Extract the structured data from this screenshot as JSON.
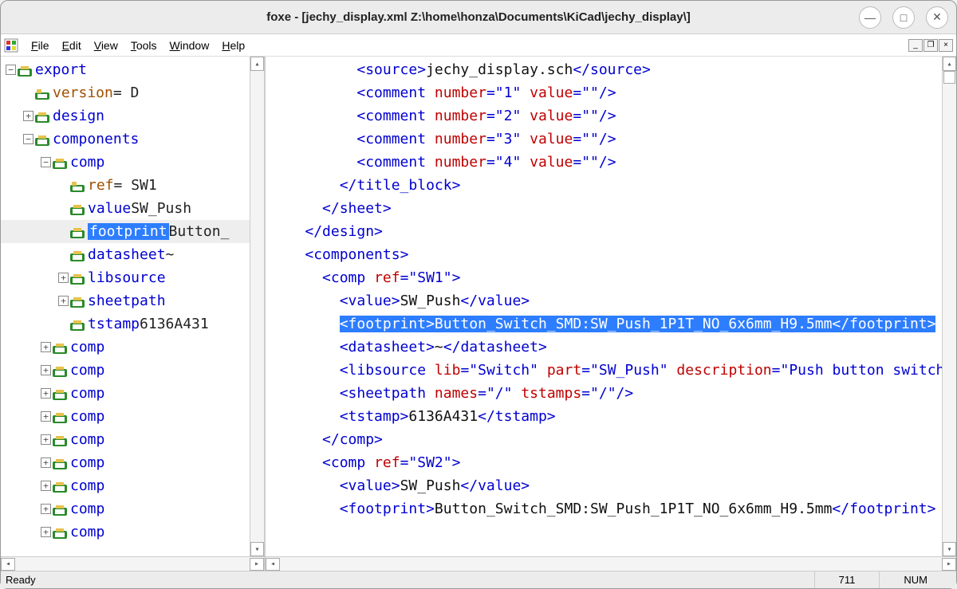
{
  "window": {
    "title": "foxe - [jechy_display.xml  Z:\\home\\honza\\Documents\\KiCad\\jechy_display\\]"
  },
  "menu": {
    "items": [
      "File",
      "Edit",
      "View",
      "Tools",
      "Window",
      "Help"
    ]
  },
  "tree": {
    "rows": [
      {
        "indent": 0,
        "exp": "-",
        "icon": "elem",
        "label": "export",
        "cls": "elem-name"
      },
      {
        "indent": 1,
        "exp": "",
        "icon": "attr",
        "label": "version",
        "cls": "brown",
        "val": " = D"
      },
      {
        "indent": 1,
        "exp": "+",
        "icon": "elem",
        "label": "design",
        "cls": "elem-name"
      },
      {
        "indent": 1,
        "exp": "-",
        "icon": "elem",
        "label": "components",
        "cls": "elem-name"
      },
      {
        "indent": 2,
        "exp": "-",
        "icon": "elem",
        "label": "comp",
        "cls": "elem-name"
      },
      {
        "indent": 3,
        "exp": "",
        "icon": "attr",
        "label": "ref",
        "cls": "brown",
        "val": " = SW1"
      },
      {
        "indent": 3,
        "exp": "",
        "icon": "elem",
        "label": "value",
        "cls": "elem-name",
        "val": " SW_Push"
      },
      {
        "indent": 3,
        "exp": "",
        "icon": "elem",
        "label": "footprint",
        "cls": "elem-name",
        "val": " Button_",
        "selected": true
      },
      {
        "indent": 3,
        "exp": "",
        "icon": "elem",
        "label": "datasheet",
        "cls": "elem-name",
        "val": " ~"
      },
      {
        "indent": 3,
        "exp": "+",
        "icon": "elem",
        "label": "libsource",
        "cls": "elem-name"
      },
      {
        "indent": 3,
        "exp": "+",
        "icon": "elem",
        "label": "sheetpath",
        "cls": "elem-name"
      },
      {
        "indent": 3,
        "exp": "",
        "icon": "elem",
        "label": "tstamp",
        "cls": "elem-name",
        "val": " 6136A431"
      },
      {
        "indent": 2,
        "exp": "+",
        "icon": "elem",
        "label": "comp",
        "cls": "elem-name"
      },
      {
        "indent": 2,
        "exp": "+",
        "icon": "elem",
        "label": "comp",
        "cls": "elem-name"
      },
      {
        "indent": 2,
        "exp": "+",
        "icon": "elem",
        "label": "comp",
        "cls": "elem-name"
      },
      {
        "indent": 2,
        "exp": "+",
        "icon": "elem",
        "label": "comp",
        "cls": "elem-name"
      },
      {
        "indent": 2,
        "exp": "+",
        "icon": "elem",
        "label": "comp",
        "cls": "elem-name"
      },
      {
        "indent": 2,
        "exp": "+",
        "icon": "elem",
        "label": "comp",
        "cls": "elem-name"
      },
      {
        "indent": 2,
        "exp": "+",
        "icon": "elem",
        "label": "comp",
        "cls": "elem-name"
      },
      {
        "indent": 2,
        "exp": "+",
        "icon": "elem",
        "label": "comp",
        "cls": "elem-name"
      },
      {
        "indent": 2,
        "exp": "+",
        "icon": "elem",
        "label": "comp",
        "cls": "elem-name"
      }
    ]
  },
  "xml": {
    "lines": [
      {
        "indent": 5,
        "tokens": [
          {
            "t": "<source>",
            "c": "tag"
          },
          {
            "t": "jechy_display.sch",
            "c": "txt"
          },
          {
            "t": "</source>",
            "c": "tag"
          }
        ]
      },
      {
        "indent": 5,
        "tokens": [
          {
            "t": "<comment ",
            "c": "tag"
          },
          {
            "t": "number",
            "c": "attr"
          },
          {
            "t": "=",
            "c": "tag"
          },
          {
            "t": "\"1\"",
            "c": "str"
          },
          {
            "t": " ",
            "c": "tag"
          },
          {
            "t": "value",
            "c": "attr"
          },
          {
            "t": "=",
            "c": "tag"
          },
          {
            "t": "\"\"",
            "c": "str"
          },
          {
            "t": "/>",
            "c": "tag"
          }
        ]
      },
      {
        "indent": 5,
        "tokens": [
          {
            "t": "<comment ",
            "c": "tag"
          },
          {
            "t": "number",
            "c": "attr"
          },
          {
            "t": "=",
            "c": "tag"
          },
          {
            "t": "\"2\"",
            "c": "str"
          },
          {
            "t": " ",
            "c": "tag"
          },
          {
            "t": "value",
            "c": "attr"
          },
          {
            "t": "=",
            "c": "tag"
          },
          {
            "t": "\"\"",
            "c": "str"
          },
          {
            "t": "/>",
            "c": "tag"
          }
        ]
      },
      {
        "indent": 5,
        "tokens": [
          {
            "t": "<comment ",
            "c": "tag"
          },
          {
            "t": "number",
            "c": "attr"
          },
          {
            "t": "=",
            "c": "tag"
          },
          {
            "t": "\"3\"",
            "c": "str"
          },
          {
            "t": " ",
            "c": "tag"
          },
          {
            "t": "value",
            "c": "attr"
          },
          {
            "t": "=",
            "c": "tag"
          },
          {
            "t": "\"\"",
            "c": "str"
          },
          {
            "t": "/>",
            "c": "tag"
          }
        ]
      },
      {
        "indent": 5,
        "tokens": [
          {
            "t": "<comment ",
            "c": "tag"
          },
          {
            "t": "number",
            "c": "attr"
          },
          {
            "t": "=",
            "c": "tag"
          },
          {
            "t": "\"4\"",
            "c": "str"
          },
          {
            "t": " ",
            "c": "tag"
          },
          {
            "t": "value",
            "c": "attr"
          },
          {
            "t": "=",
            "c": "tag"
          },
          {
            "t": "\"\"",
            "c": "str"
          },
          {
            "t": "/>",
            "c": "tag"
          }
        ]
      },
      {
        "indent": 4,
        "tokens": [
          {
            "t": "</title_block>",
            "c": "tag"
          }
        ]
      },
      {
        "indent": 3,
        "tokens": [
          {
            "t": "</sheet>",
            "c": "tag"
          }
        ]
      },
      {
        "indent": 2,
        "tokens": [
          {
            "t": "</design>",
            "c": "tag"
          }
        ]
      },
      {
        "indent": 2,
        "tokens": [
          {
            "t": "<components>",
            "c": "tag"
          }
        ]
      },
      {
        "indent": 3,
        "tokens": [
          {
            "t": "<comp ",
            "c": "tag"
          },
          {
            "t": "ref",
            "c": "attr"
          },
          {
            "t": "=",
            "c": "tag"
          },
          {
            "t": "\"SW1\"",
            "c": "str"
          },
          {
            "t": ">",
            "c": "tag"
          }
        ]
      },
      {
        "indent": 4,
        "tokens": [
          {
            "t": "<value>",
            "c": "tag"
          },
          {
            "t": "SW_Push",
            "c": "txt"
          },
          {
            "t": "</value>",
            "c": "tag"
          }
        ]
      },
      {
        "indent": 4,
        "hl": true,
        "tokens": [
          {
            "t": "<footprint>",
            "c": "tag"
          },
          {
            "t": "Button_Switch_SMD:SW_Push_1P1T_NO_6x6mm_H9.5mm",
            "c": "txt"
          },
          {
            "t": "</footprint>",
            "c": "tag"
          }
        ]
      },
      {
        "indent": 4,
        "tokens": [
          {
            "t": "<datasheet>",
            "c": "tag"
          },
          {
            "t": "~",
            "c": "txt"
          },
          {
            "t": "</datasheet>",
            "c": "tag"
          }
        ]
      },
      {
        "indent": 4,
        "tokens": [
          {
            "t": "<libsource ",
            "c": "tag"
          },
          {
            "t": "lib",
            "c": "attr"
          },
          {
            "t": "=",
            "c": "tag"
          },
          {
            "t": "\"Switch\"",
            "c": "str"
          },
          {
            "t": " ",
            "c": "tag"
          },
          {
            "t": "part",
            "c": "attr"
          },
          {
            "t": "=",
            "c": "tag"
          },
          {
            "t": "\"SW_Push\"",
            "c": "str"
          },
          {
            "t": " ",
            "c": "tag"
          },
          {
            "t": "description",
            "c": "attr"
          },
          {
            "t": "=",
            "c": "tag"
          },
          {
            "t": "\"Push button switch,",
            "c": "str"
          }
        ]
      },
      {
        "indent": 4,
        "tokens": [
          {
            "t": "<sheetpath ",
            "c": "tag"
          },
          {
            "t": "names",
            "c": "attr"
          },
          {
            "t": "=",
            "c": "tag"
          },
          {
            "t": "\"/\"",
            "c": "str"
          },
          {
            "t": " ",
            "c": "tag"
          },
          {
            "t": "tstamps",
            "c": "attr"
          },
          {
            "t": "=",
            "c": "tag"
          },
          {
            "t": "\"/\"",
            "c": "str"
          },
          {
            "t": "/>",
            "c": "tag"
          }
        ]
      },
      {
        "indent": 4,
        "tokens": [
          {
            "t": "<tstamp>",
            "c": "tag"
          },
          {
            "t": "6136A431",
            "c": "txt"
          },
          {
            "t": "</tstamp>",
            "c": "tag"
          }
        ]
      },
      {
        "indent": 3,
        "tokens": [
          {
            "t": "</comp>",
            "c": "tag"
          }
        ]
      },
      {
        "indent": 3,
        "tokens": [
          {
            "t": "<comp ",
            "c": "tag"
          },
          {
            "t": "ref",
            "c": "attr"
          },
          {
            "t": "=",
            "c": "tag"
          },
          {
            "t": "\"SW2\"",
            "c": "str"
          },
          {
            "t": ">",
            "c": "tag"
          }
        ]
      },
      {
        "indent": 4,
        "tokens": [
          {
            "t": "<value>",
            "c": "tag"
          },
          {
            "t": "SW_Push",
            "c": "txt"
          },
          {
            "t": "</value>",
            "c": "tag"
          }
        ]
      },
      {
        "indent": 4,
        "tokens": [
          {
            "t": "<footprint>",
            "c": "tag"
          },
          {
            "t": "Button_Switch_SMD:SW_Push_1P1T_NO_6x6mm_H9.5mm",
            "c": "txt"
          },
          {
            "t": "</footprint>",
            "c": "tag"
          }
        ]
      }
    ]
  },
  "status": {
    "left": "Ready",
    "pos": "711",
    "mode": "NUM"
  }
}
